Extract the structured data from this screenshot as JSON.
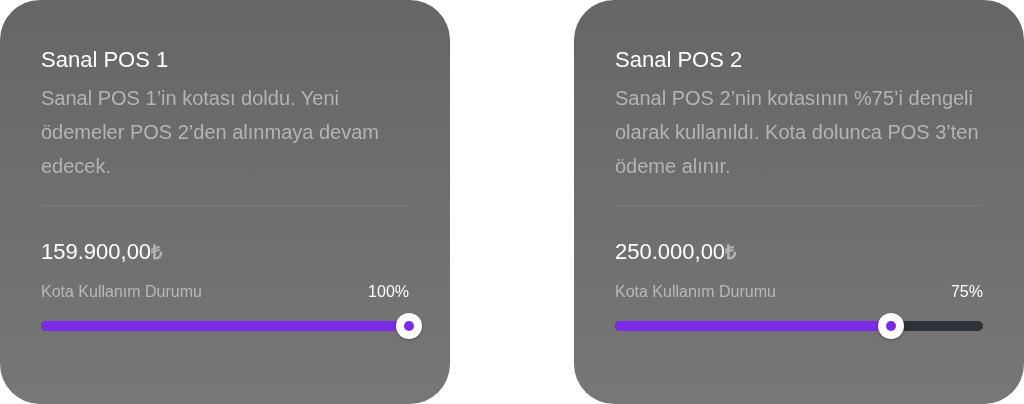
{
  "cards": [
    {
      "title": "Sanal POS 1",
      "description": "Sanal POS 1’in kotası doldu. Yeni ödemeler POS 2’den alınmaya devam edecek.",
      "amount": "159.900,00",
      "currency": "₺",
      "quota_label": "Kota Kullanım Durumu",
      "percent": "100%",
      "level": 1
    },
    {
      "title": "Sanal POS 2",
      "description": "Sanal POS 2’nin kotasının %75’i dengeli olarak kullanıldı. Kota dolunca POS 3’ten ödeme alınır.",
      "amount": "250.000,00",
      "currency": "₺",
      "quota_label": "Kota Kullanım Durumu",
      "percent": "75%",
      "level": 0.75
    }
  ]
}
